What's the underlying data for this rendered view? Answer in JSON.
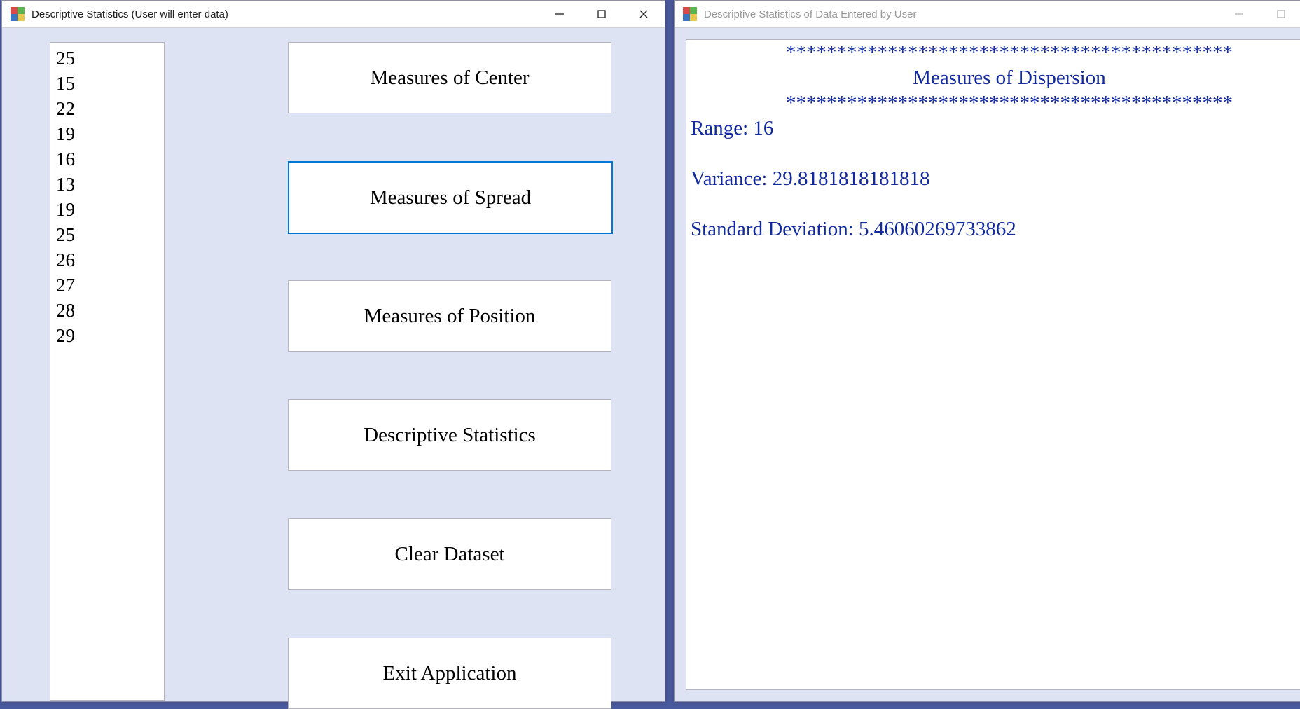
{
  "window1": {
    "title": "Descriptive Statistics (User will enter data)",
    "data_values": [
      "25",
      "15",
      "22",
      "19",
      "16",
      "13",
      "19",
      "25",
      "26",
      "27",
      "28",
      "29"
    ],
    "buttons": {
      "center": "Measures of Center",
      "spread": "Measures of Spread",
      "position": "Measures of Position",
      "desc": "Descriptive Statistics",
      "clear": "Clear Dataset",
      "exit": "Exit Application"
    }
  },
  "window2": {
    "title": "Descriptive Statistics of Data Entered by User",
    "output": {
      "stars": "********************************************",
      "heading": "Measures of Dispersion",
      "range_line": "Range: 16",
      "variance_line": "Variance: 29.8181818181818",
      "stddev_line": "Standard Deviation: 5.46060269733862"
    }
  }
}
